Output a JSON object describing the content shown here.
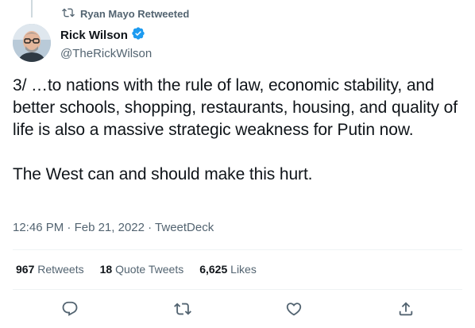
{
  "retweet": {
    "text": "Ryan Mayo Retweeted",
    "icon": "retweet-icon"
  },
  "author": {
    "name": "Rick Wilson",
    "handle": "@TheRickWilson",
    "verified": true,
    "avatar": "avatar-photo"
  },
  "tweet": {
    "text": "3/ …to nations with the rule of law, economic stability, and better schools, shopping, restaurants, housing, and quality of life is also a massive strategic weakness for Putin now.\n\nThe West can and should make this hurt."
  },
  "meta": {
    "time": "12:46 PM",
    "sep1": " · ",
    "date": "Feb 21, 2022",
    "sep2": " · ",
    "source": "TweetDeck"
  },
  "stats": {
    "retweets_count": "967",
    "retweets_label": "Retweets",
    "quotes_count": "18",
    "quotes_label": "Quote Tweets",
    "likes_count": "6,625",
    "likes_label": "Likes"
  },
  "actions": [
    "reply-icon",
    "retweet-icon",
    "like-icon",
    "share-icon"
  ],
  "colors": {
    "text": "#0f1419",
    "secondary": "#536471",
    "verified": "#1d9bf0",
    "divider": "#eff3f4"
  }
}
